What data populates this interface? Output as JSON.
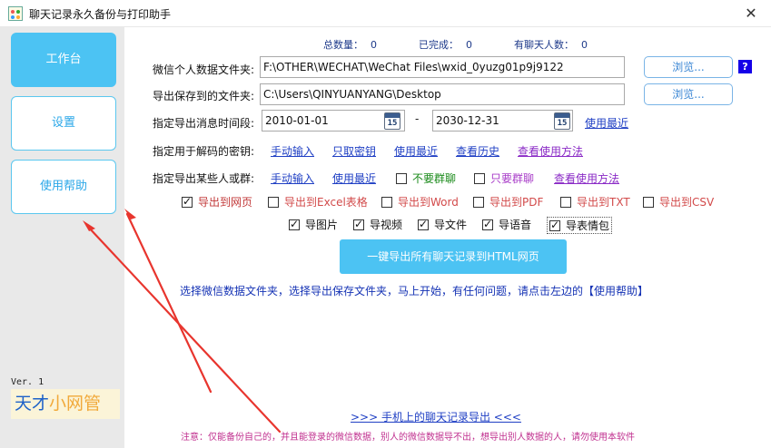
{
  "app": {
    "title": "聊天记录永久备份与打印助手"
  },
  "sidebar": {
    "items": [
      {
        "label": "工作台"
      },
      {
        "label": "设置"
      },
      {
        "label": "使用帮助"
      }
    ],
    "version": "Ver. 1",
    "logo_a": "天才",
    "logo_b": "小网管"
  },
  "stats": {
    "total_label": "总数量：",
    "total_value": "0",
    "done_label": "已完成：",
    "done_value": "0",
    "persons_label": "有聊天人数：",
    "persons_value": "0"
  },
  "form": {
    "data_folder_label": "微信个人数据文件夹:",
    "data_folder_value": "F:\\OTHER\\WECHAT\\WeChat Files\\wxid_0yuzg01p9j9122",
    "save_folder_label": "导出保存到的文件夹:",
    "save_folder_value": "C:\\Users\\QINYUANYANG\\Desktop",
    "browse_label": "浏览...",
    "help_q": "?",
    "time_label": "指定导出消息时间段:",
    "date_from": "2010-01-01",
    "date_to": "2030-12-31",
    "cal_num": "15",
    "dash": "-",
    "use_recent_label": "使用最近",
    "key_label": "指定用于解码的密钥:",
    "key_links": [
      "手动输入",
      "只取密钥",
      "使用最近",
      "查看历史",
      "查看使用方法"
    ],
    "persons_label": "指定导出某些人或群:",
    "persons_links": [
      "手动输入",
      "使用最近"
    ],
    "no_group_label": "不要群聊",
    "only_group_label": "只要群聊",
    "persons_method_label": "查看使用方法"
  },
  "export_opts": [
    {
      "label": "导出到网页",
      "checked": true
    },
    {
      "label": "导出到Excel表格",
      "checked": false
    },
    {
      "label": "导出到Word",
      "checked": false
    },
    {
      "label": "导出到PDF",
      "checked": false
    },
    {
      "label": "导出到TXT",
      "checked": false
    },
    {
      "label": "导出到CSV",
      "checked": false
    }
  ],
  "media_opts": [
    {
      "label": "导图片",
      "checked": true
    },
    {
      "label": "导视频",
      "checked": true
    },
    {
      "label": "导文件",
      "checked": true
    },
    {
      "label": "导语音",
      "checked": true
    },
    {
      "label": "导表情包",
      "checked": true
    }
  ],
  "main_button": "一键导出所有聊天记录到HTML网页",
  "hint": "选择微信数据文件夹，选择导出保存文件夹，马上开始，有任何问题，请点击左边的【使用帮助】",
  "mobile_link": ">>>   手机上的聊天记录导出   <<<",
  "notice": "注意：仅能备份自己的，并且能登录的微信数据，别人的微信数据导不出，想导出别人数据的人，请勿使用本软件",
  "colors": {
    "accent": "#4cc3f3",
    "link": "#1f3fc4",
    "arrow": "#e8352e",
    "notice": "#c0308f"
  }
}
